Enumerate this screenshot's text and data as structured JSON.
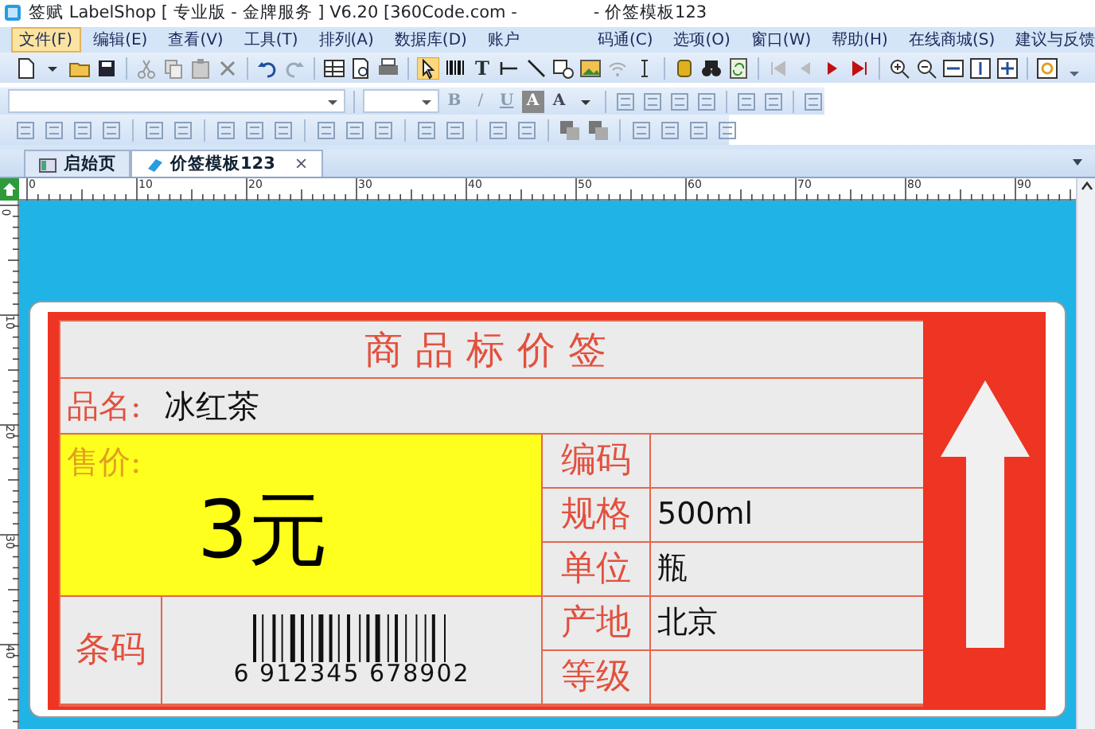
{
  "window": {
    "title_start": "签赋 LabelShop [ 专业版 - 金牌服务 ] V6.20 [360Code.com -",
    "title_end": "- 价签模板123"
  },
  "menu": [
    {
      "label": "文件(F)",
      "selected": true
    },
    {
      "label": "编辑(E)",
      "selected": false
    },
    {
      "label": "查看(V)",
      "selected": false
    },
    {
      "label": "工具(T)",
      "selected": false
    },
    {
      "label": "排列(A)",
      "selected": false
    },
    {
      "label": "数据库(D)",
      "selected": false
    },
    {
      "label": "账户",
      "selected": false
    },
    {
      "label": "码通(C)",
      "selected": false
    },
    {
      "label": "选项(O)",
      "selected": false
    },
    {
      "label": "窗口(W)",
      "selected": false
    },
    {
      "label": "帮助(H)",
      "selected": false
    },
    {
      "label": "在线商城(S)",
      "selected": false
    },
    {
      "label": "建议与反馈",
      "selected": false
    }
  ],
  "toolbar": {
    "text_tool": "T"
  },
  "format_buttons": [
    {
      "label": "B",
      "kind": "bold"
    },
    {
      "label": "/",
      "kind": "italic"
    },
    {
      "label": "U",
      "kind": "underline"
    },
    {
      "label": "A",
      "kind": "highlight"
    },
    {
      "label": "A",
      "kind": "color"
    }
  ],
  "tabs": [
    {
      "label": "启始页",
      "selected": false
    },
    {
      "label": "价签模板123",
      "selected": true,
      "close": "×"
    }
  ],
  "ruler": {
    "top_labels": [
      "0",
      "10",
      "20",
      "30",
      "40",
      "50",
      "60",
      "70",
      "80",
      "90"
    ],
    "left_labels": [
      "0",
      "10",
      "20",
      "30",
      "40"
    ]
  },
  "label": {
    "title": "商品标价签",
    "name_label": "品名:",
    "name_value": "冰红茶",
    "price_label": "售价:",
    "price_value": "3元",
    "barcode_label": "条码",
    "barcode_number": "6 912345 678902",
    "fields": [
      {
        "label": "编码"
      },
      {
        "label": "规格",
        "value": "500ml"
      },
      {
        "label": "单位",
        "value": "瓶"
      },
      {
        "label": "产地",
        "value": "北京"
      },
      {
        "label": "等级"
      }
    ]
  }
}
